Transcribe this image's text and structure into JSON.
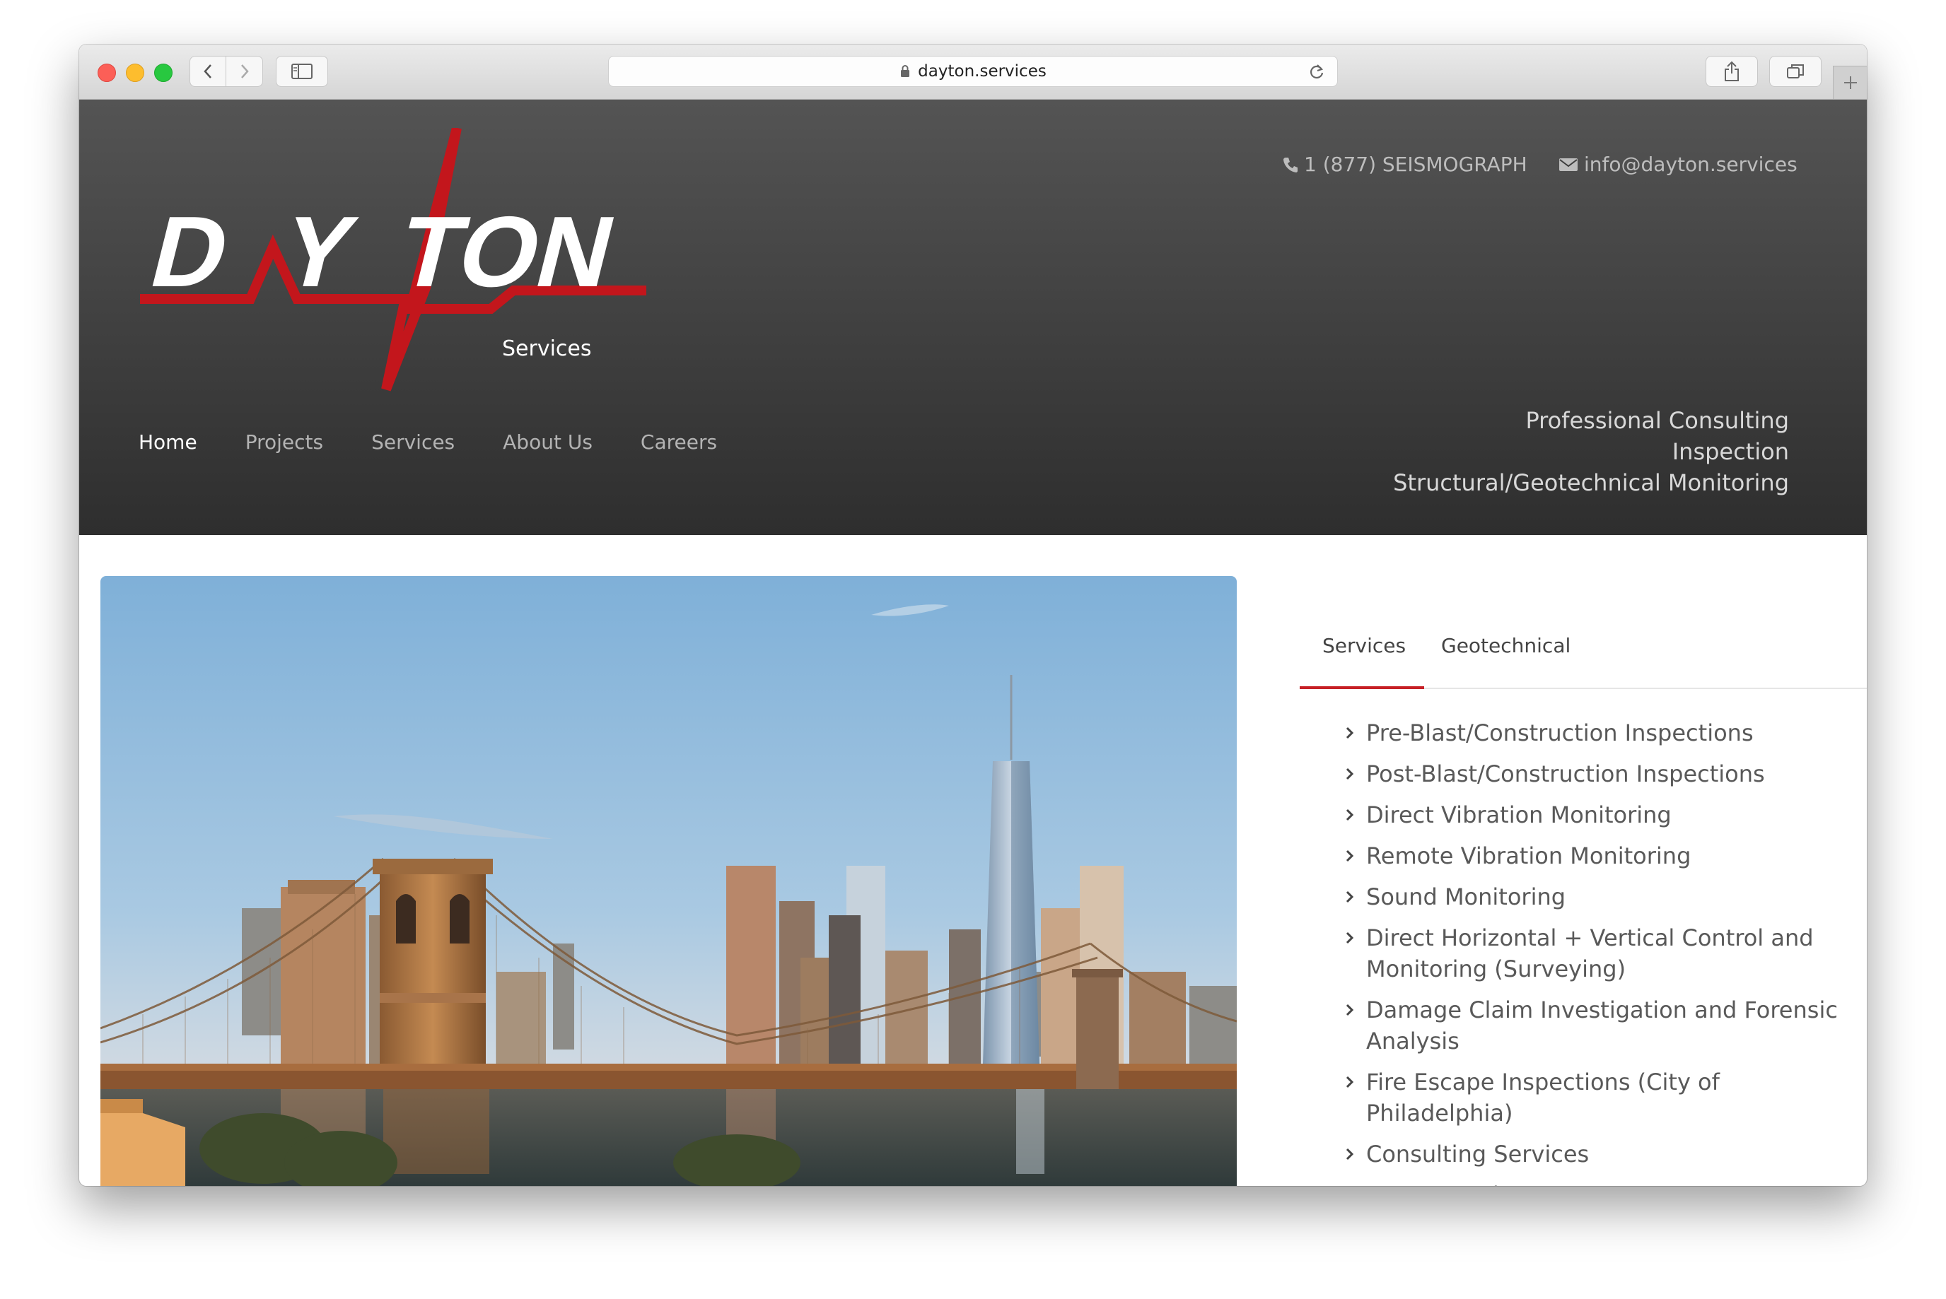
{
  "browser": {
    "url": "dayton.services"
  },
  "header": {
    "phone": "1 (877) SEISMOGRAPH",
    "email": "info@dayton.services",
    "logo": {
      "wordmark": "DAYTON",
      "subtitle": "Services"
    },
    "nav": [
      "Home",
      "Projects",
      "Services",
      "About Us",
      "Careers"
    ],
    "taglines": [
      "Professional Consulting",
      "Inspection",
      "Structural/Geotechnical Monitoring"
    ]
  },
  "tabs": [
    "Services",
    "Geotechnical"
  ],
  "services": [
    "Pre-Blast/Construction Inspections",
    "Post-Blast/Construction Inspections",
    "Direct Vibration Monitoring",
    "Remote Vibration Monitoring",
    "Sound Monitoring",
    "Direct Horizontal + Vertical Control and Monitoring (Surveying)",
    "Damage Claim Investigation and Forensic Analysis",
    "Fire Escape Inspections (City of Philadelphia)",
    "Consulting Services",
    "Drone Services"
  ],
  "colors": {
    "accent": "#c62026",
    "header_top": "#545454",
    "header_bottom": "#2e2e2e"
  }
}
